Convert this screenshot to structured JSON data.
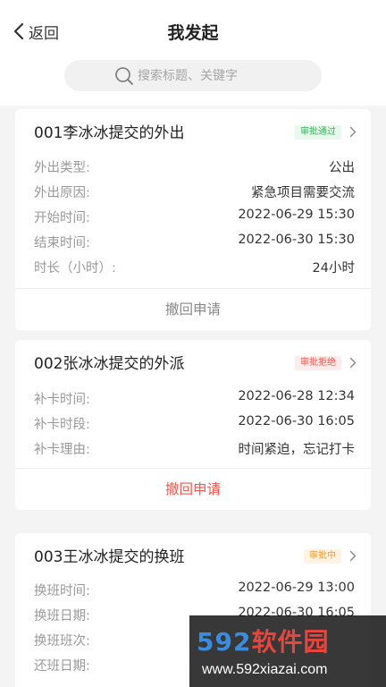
{
  "header": {
    "back_label": "返回",
    "title": "我发起"
  },
  "search": {
    "placeholder": "搜索标题、关键字"
  },
  "colors": {
    "approved_bg": "#e8f8ec",
    "approved_fg": "#3bb05a",
    "rejected_bg": "#fdecec",
    "rejected_fg": "#ea5a52",
    "pending_bg": "#fff3e3",
    "pending_fg": "#f29a33",
    "action_red": "#ea5a52",
    "action_gray": "#888888"
  },
  "cards": [
    {
      "title": "001李冰冰提交的外出",
      "status": "审批通过",
      "rows": [
        {
          "label": "外出类型:",
          "value": "公出"
        },
        {
          "label": "外出原因:",
          "value": "紧急项目需要交流"
        },
        {
          "label": "开始时间:",
          "value": "2022-06-29 15:30"
        },
        {
          "label": "结束时间:",
          "value": "2022-06-30 15:30"
        },
        {
          "label": "时长（小时）:",
          "value": "24小时"
        }
      ],
      "action": "撤回申请"
    },
    {
      "title": "002张冰冰提交的外派",
      "status": "审批拒绝",
      "rows": [
        {
          "label": "补卡时间:",
          "value": "2022-06-28 12:34"
        },
        {
          "label": "补卡时段:",
          "value": "2022-06-30 16:05"
        },
        {
          "label": "补卡理由:",
          "value": "时间紧迫，忘记打卡"
        }
      ],
      "action": "撤回申请"
    },
    {
      "title": "003王冰冰提交的换班",
      "status": "审批中",
      "rows": [
        {
          "label": "换班时间:",
          "value": "2022-06-29 13:00"
        },
        {
          "label": "换班日期:",
          "value": "2022-06-30 16:05"
        },
        {
          "label": "换班班次:",
          "value": ""
        },
        {
          "label": "还班日期:",
          "value": ""
        }
      ]
    }
  ],
  "watermark": {
    "logo": "592软件园",
    "url": "www.592xiazai.com"
  }
}
